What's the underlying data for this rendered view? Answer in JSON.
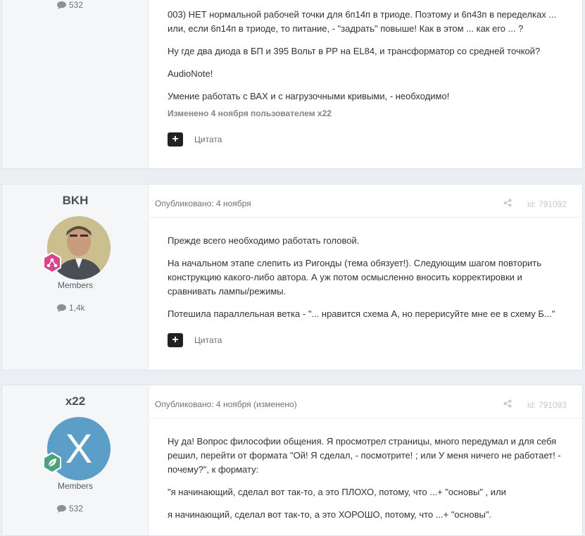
{
  "posts": [
    {
      "count": "532",
      "paragraphs": [
        "003) НЕТ нормальной рабочей точки для 6п14п в триоде. Поэтому и 6п43п в переделках ... или, если 6п14п в триоде, то питание, -  \"задрать\" повыше! Как в этом ... как его ... ?",
        "Ну где два диода в БП и 395 Вольт в РР на EL84, и трансформатор со средней точкой?",
        "AudioNote!",
        "Умение работать с ВАХ  и с нагрузочными кривыми, - необходимо!"
      ],
      "edited_note": "Изменено 4 ноября пользователем x22",
      "quote_label": "Цитата"
    },
    {
      "author": "BKH",
      "group": "Members",
      "count": "1,4k",
      "published": "Опубликовано: 4 ноября",
      "post_id": "id: 791092",
      "paragraphs": [
        "Прежде всего необходимо работать головой.",
        "На начальном этапе слепить из Ригонды (тема обязует!). Следующим шагом повторить конструкцию какого-либо автора. А уж потом осмысленно вносить корректировки и сравнивать лампы/режимы.",
        "Потешила параллельная ветка - \"... нравится схема А, но перерисуйте мне ее в схему Б...\""
      ],
      "quote_label": "Цитата"
    },
    {
      "author": "x22",
      "avatar_letter": "X",
      "group": "Members",
      "count": "532",
      "published": "Опубликовано: 4 ноября (изменено)",
      "post_id": "id: 791093",
      "paragraphs": [
        "Ну да! Вопрос философии общения. Я просмотрел страницы, много передумал и для себя решил, перейти от формата \"Ой! Я сделал, - посмотрите! ; или У меня ничего не работает! - почему?\", к формату:",
        "\"я начинающий, сделал вот так-то, а это ПЛОХО, потому, что ...+ \"основы\" , или",
        "я начинающий, сделал вот так-то, а это ХОРОШО, потому, что ...+ \"основы\"."
      ]
    }
  ],
  "colors": {
    "badge_pink": "#d9468d",
    "badge_green": "#4aa37a",
    "avatar_blue": "#5b9fc9"
  },
  "icons": [
    "comment-icon",
    "share-icon",
    "plus-icon",
    "rank-badge-icon",
    "leaf-icon"
  ]
}
